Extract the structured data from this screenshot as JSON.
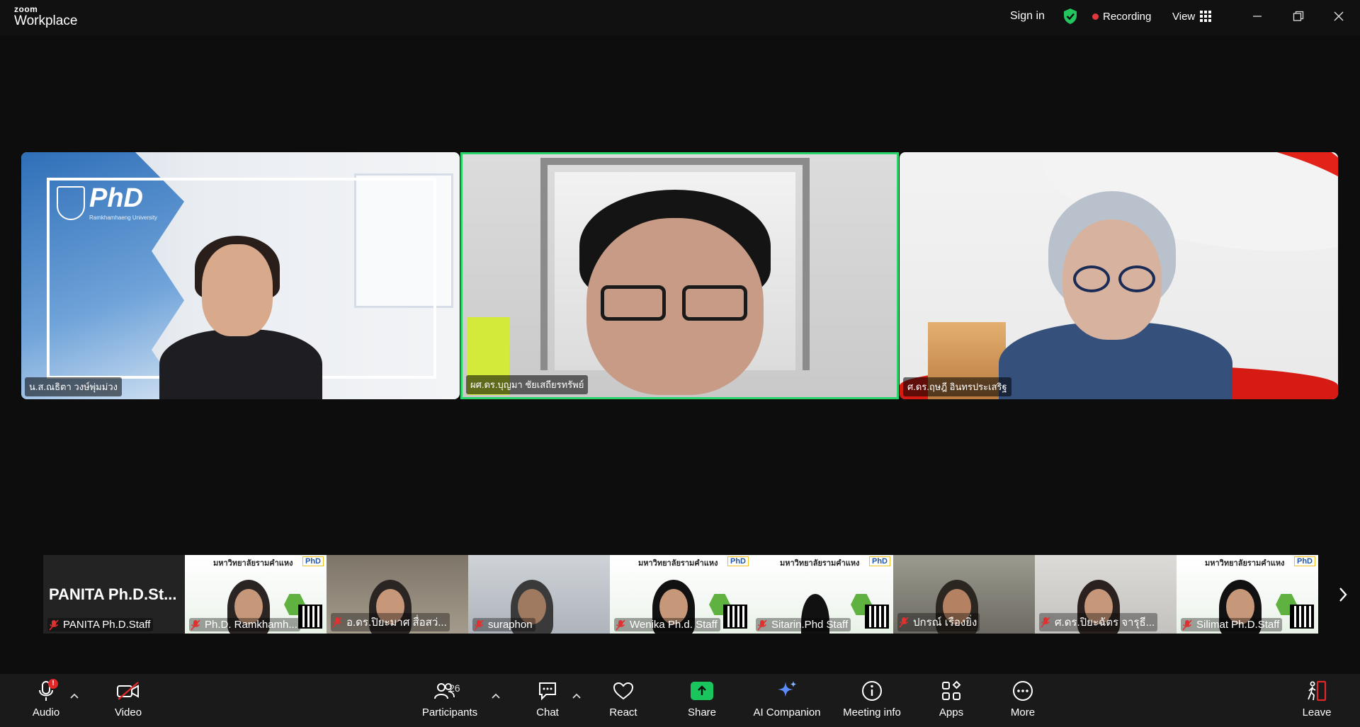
{
  "app": {
    "brand_small": "zoom",
    "brand_big": "Workplace"
  },
  "titlebar": {
    "sign_in": "Sign in",
    "recording": "Recording",
    "view": "View",
    "shield_color": "#22c55e",
    "recording_dot_color": "#e0383e"
  },
  "gallery": [
    {
      "name": "น.ส.ณธิตา วงษ์พุ่มม่วง",
      "active_speaker": false,
      "logo_text": "PhD",
      "logo_sub": "Ramkhamhaeng University"
    },
    {
      "name": "ผศ.ดร.บุญมา ชัยเสถียรทรัพย์",
      "active_speaker": true
    },
    {
      "name": "ศ.ดร.ฤษฎี อินทรประเสริฐ",
      "active_speaker": false
    }
  ],
  "active_speaker_color": "#2bd46a",
  "filmstrip": [
    {
      "big_text": "PANITA  Ph.D.St...",
      "label": "PANITA Ph.D.Staff",
      "muted": true,
      "bg": "dark"
    },
    {
      "label": "Ph.D. Ramkhamh...",
      "muted": true,
      "bg": "poster",
      "poster_title": "มหาวิทยาลัยรามคำแหง",
      "poster_logo": "PhD"
    },
    {
      "label": "อ.ดร.ปิยะมาศ  สื่อสว่...",
      "muted": true,
      "bg": "room"
    },
    {
      "label": "suraphon",
      "muted": true,
      "bg": "office"
    },
    {
      "label": "Wenika Ph.d. Staff",
      "muted": true,
      "bg": "poster",
      "poster_title": "มหาวิทยาลัยรามคำแหง",
      "poster_logo": "PhD"
    },
    {
      "label": "Sitarin.Phd Staff",
      "muted": true,
      "bg": "poster",
      "poster_title": "มหาวิทยาลัยรามคำแหง",
      "poster_logo": "PhD"
    },
    {
      "label": "ปกรณ์ เรืองยิ่ง",
      "muted": true,
      "bg": "blurred"
    },
    {
      "label": "ศ.ดร.ปิยะฉัตร จารุธี...",
      "muted": true,
      "bg": "wall"
    },
    {
      "label": "Silimat Ph.D.Staff",
      "muted": true,
      "bg": "poster",
      "poster_title": "มหาวิทยาลัยรามคำแหง",
      "poster_logo": "PhD"
    }
  ],
  "toolbar": {
    "audio": "Audio",
    "audio_badge": "!",
    "video": "Video",
    "participants": "Participants",
    "participants_count": "26",
    "chat": "Chat",
    "react": "React",
    "share": "Share",
    "ai_companion": "AI Companion",
    "meeting_info": "Meeting info",
    "apps": "Apps",
    "more": "More",
    "leave": "Leave",
    "share_color": "#19c55c",
    "leave_color": "#e02828"
  }
}
